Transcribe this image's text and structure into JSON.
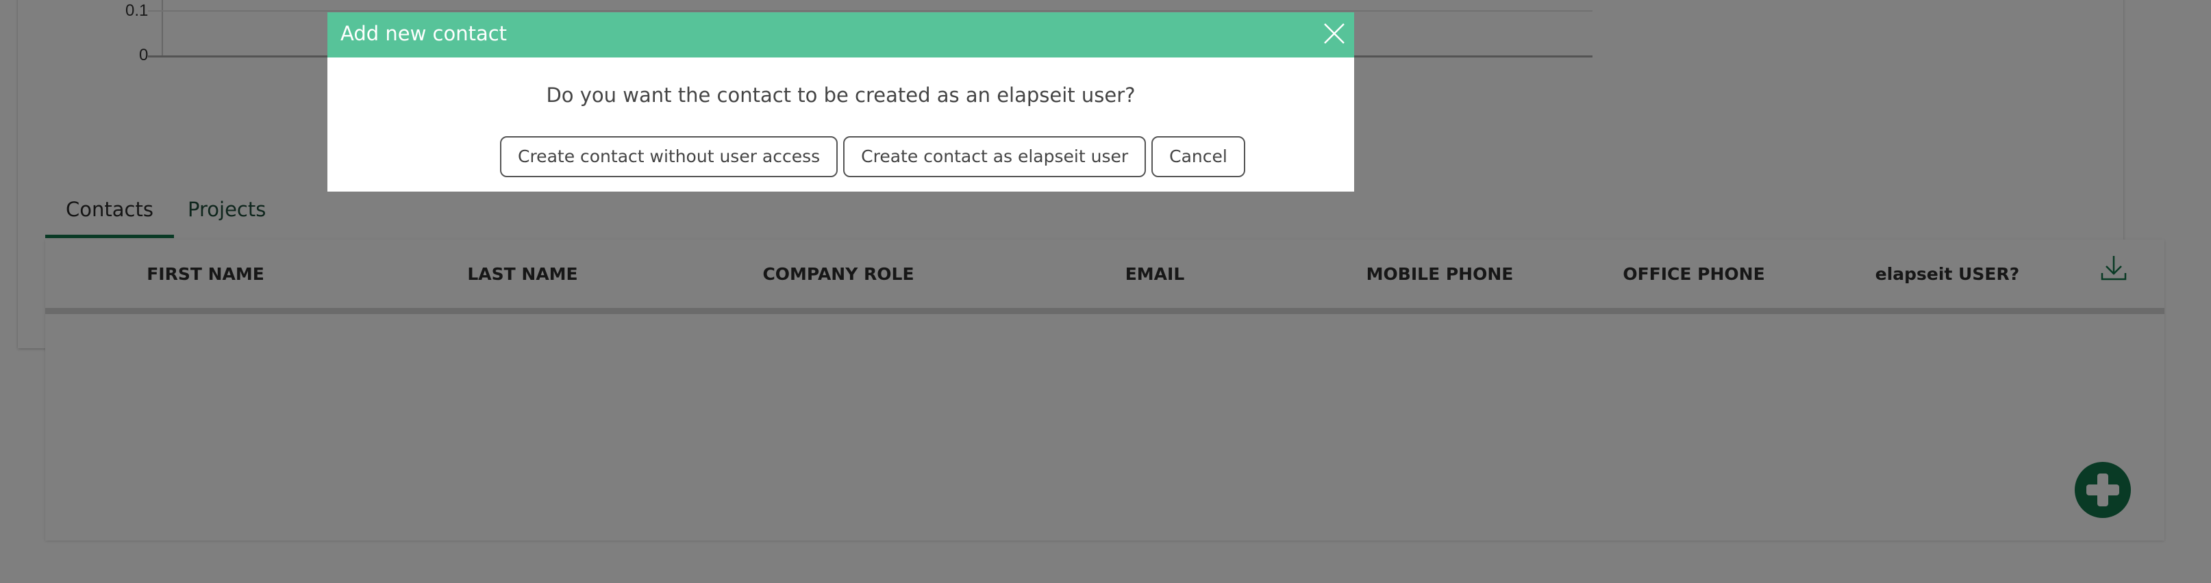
{
  "chart": {
    "y_ticks": [
      "0.1",
      "0"
    ]
  },
  "chart_data": {
    "type": "line",
    "title": "",
    "xlabel": "",
    "ylabel": "",
    "y_tick_labels": [
      "0",
      "0.1"
    ],
    "series": []
  },
  "tabs": [
    {
      "label": "Contacts",
      "active": true
    },
    {
      "label": "Projects",
      "active": false
    }
  ],
  "table": {
    "columns": [
      "FIRST NAME",
      "LAST NAME",
      "COMPANY ROLE",
      "EMAIL",
      "MOBILE PHONE",
      "OFFICE PHONE",
      "elapseit USER?"
    ],
    "rows": [],
    "download_icon": "download-icon"
  },
  "fab": {
    "icon": "plus-icon"
  },
  "modal": {
    "title": "Add new contact",
    "question": "Do you want the contact to be created as an elapseit user?",
    "buttons": {
      "without_access": "Create contact without user access",
      "as_user": "Create contact as elapseit user",
      "cancel": "Cancel"
    },
    "close_icon": "close-icon"
  },
  "colors": {
    "modal_header": "#57c399",
    "accent": "#13744a",
    "overlay": "rgba(0,0,0,0.5)"
  }
}
